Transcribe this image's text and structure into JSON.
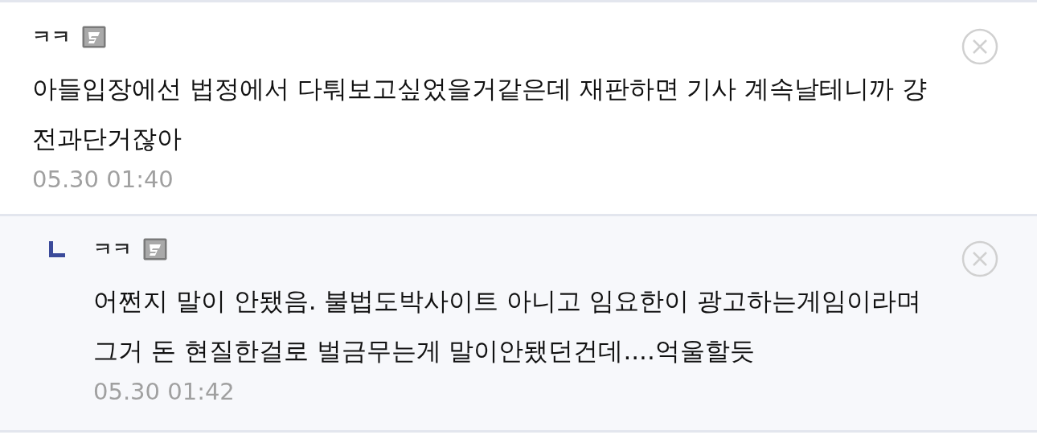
{
  "comments": [
    {
      "kind": "comment",
      "author": "ㅋㅋ",
      "lines": [
        "아들입장에선 법정에서 다퉈보고싶었을거같은데 재판하면 기사 계속날테니까 걍",
        "전과단거잖아"
      ],
      "date": "05.30 01:40"
    },
    {
      "kind": "reply",
      "author": "ㅋㅋ",
      "lines": [
        "어쩐지 말이 안됐음. 불법도박사이트 아니고 임요한이 광고하는게임이라며",
        "그거 돈 현질한걸로 벌금무는게 말이안됐던건데....억울할듯"
      ],
      "date": "05.30 01:42"
    }
  ]
}
